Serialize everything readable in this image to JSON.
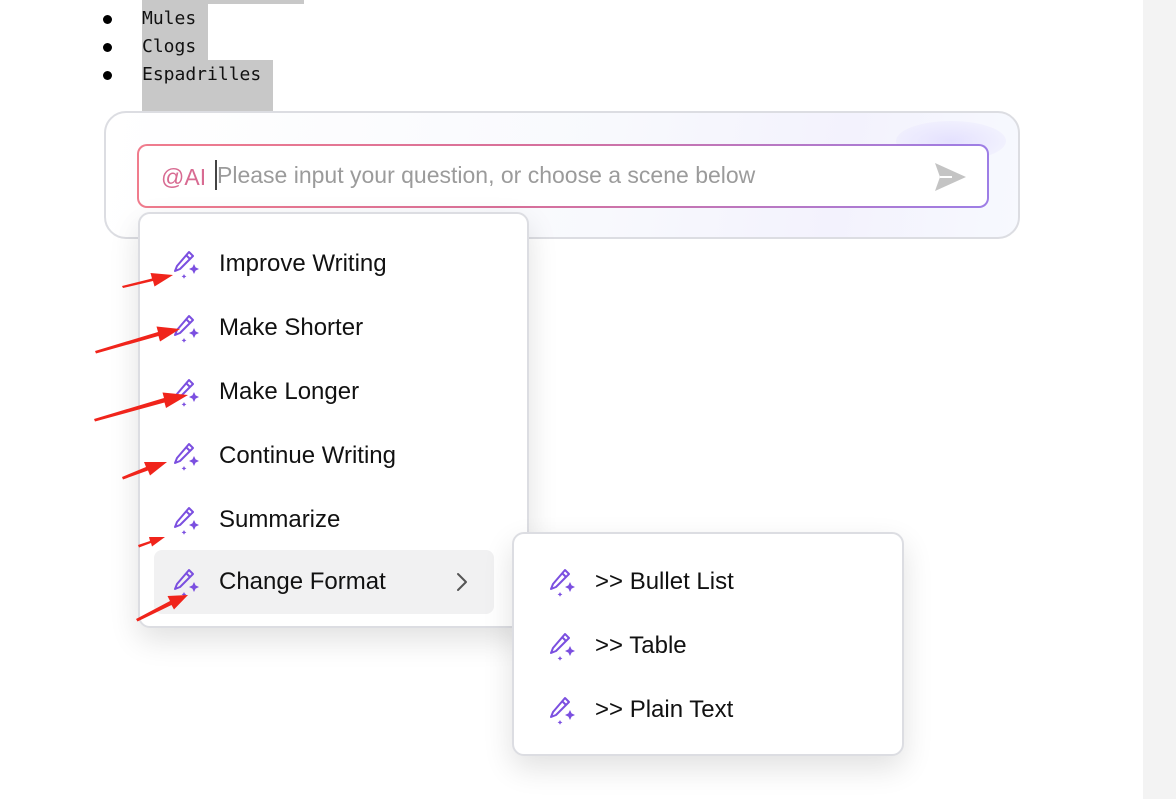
{
  "document": {
    "list_items": [
      "Mules",
      "Clogs",
      "Espadrilles"
    ]
  },
  "ai_panel": {
    "tag": "@AI",
    "input_value": "",
    "placeholder": "Please input your question, or choose a scene below"
  },
  "menu": {
    "items": [
      {
        "label": "Improve Writing"
      },
      {
        "label": "Make Shorter"
      },
      {
        "label": "Make Longer"
      },
      {
        "label": "Continue Writing"
      },
      {
        "label": "Summarize"
      },
      {
        "label": "Change Format",
        "has_submenu": true,
        "active": true
      }
    ]
  },
  "submenu": {
    "items": [
      {
        "label": ">> Bullet List"
      },
      {
        "label": ">> Table"
      },
      {
        "label": ">> Plain Text"
      }
    ]
  },
  "icons": {
    "menu_item": "ai-pen-sparkle-icon",
    "send": "send-arrow-icon",
    "submenu": "chevron-right-icon"
  },
  "colors": {
    "icon_purple": "#7b4fe0",
    "arrow_red": "#f0241b",
    "input_gradient_start": "#f07c8d",
    "input_gradient_end": "#9d7ee6"
  }
}
